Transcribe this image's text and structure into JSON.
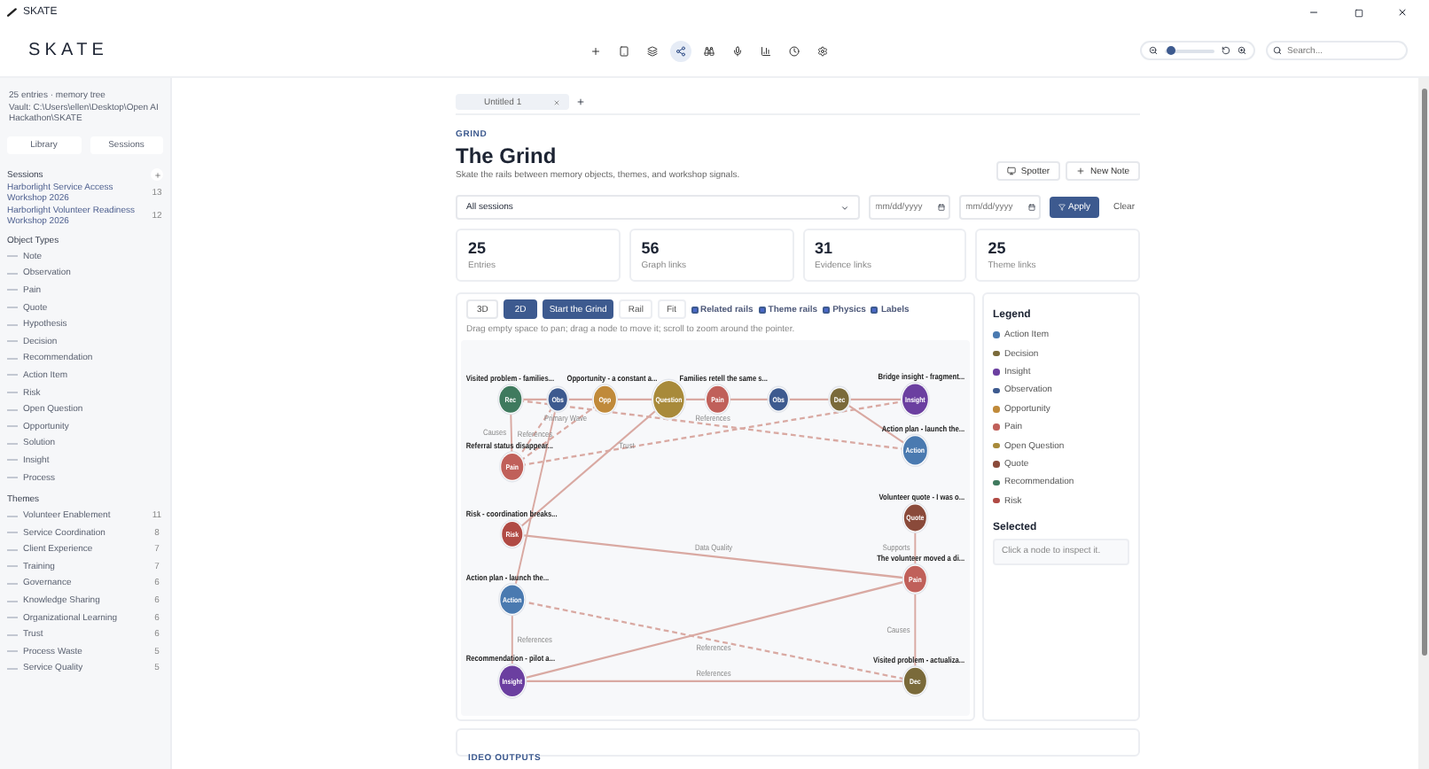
{
  "window": {
    "title": "SKATE"
  },
  "app_bar": {
    "logo": "SKATE",
    "tools": [
      {
        "kind": "add",
        "selected": false
      },
      {
        "kind": "tablet",
        "selected": false
      },
      {
        "kind": "layers",
        "selected": false
      },
      {
        "kind": "graph",
        "selected": true
      },
      {
        "kind": "binoculars",
        "selected": false
      },
      {
        "kind": "mic",
        "selected": false
      },
      {
        "kind": "chart",
        "selected": false
      },
      {
        "kind": "clock",
        "selected": false
      },
      {
        "kind": "settings",
        "selected": false
      }
    ],
    "zoom": {
      "level": 0.12
    },
    "search": {
      "placeholder": "Search..."
    }
  },
  "sidebar": {
    "info": [
      "25 entries · memory tree",
      "Vault: C:\\Users\\ellen\\Desktop\\Open AI Hackathon\\SKATE"
    ],
    "buttons": [
      "Library",
      "Sessions"
    ],
    "sessions_heading": "Sessions",
    "sessions": [
      {
        "label": "Harborlight Service Access Workshop 2026",
        "count": "13"
      },
      {
        "label": "Harborlight Volunteer Readiness Workshop 2026",
        "count": "12"
      }
    ],
    "object_types_heading": "Object Types",
    "object_types": [
      "Note",
      "Observation",
      "Pain",
      "Quote",
      "Hypothesis",
      "Decision",
      "Recommendation",
      "Action Item",
      "Risk",
      "Open Question",
      "Opportunity",
      "Solution",
      "Insight",
      "Process"
    ],
    "themes_heading": "Themes",
    "themes": [
      {
        "label": "Volunteer Enablement",
        "count": "11"
      },
      {
        "label": "Service Coordination",
        "count": "8"
      },
      {
        "label": "Client Experience",
        "count": "7"
      },
      {
        "label": "Training",
        "count": "7"
      },
      {
        "label": "Governance",
        "count": "6"
      },
      {
        "label": "Knowledge Sharing",
        "count": "6"
      },
      {
        "label": "Organizational Learning",
        "count": "6"
      },
      {
        "label": "Trust",
        "count": "6"
      },
      {
        "label": "Process Waste",
        "count": "5"
      },
      {
        "label": "Service Quality",
        "count": "5"
      }
    ]
  },
  "tabs": [
    {
      "label": "Untitled 1",
      "selected": true
    }
  ],
  "header": {
    "eyebrow": "GRIND",
    "title": "The Grind",
    "subtitle": "Skate the rails between memory objects, themes, and workshop signals.",
    "actions": [
      {
        "kind": "spotter",
        "label": "Spotter"
      },
      {
        "kind": "add",
        "label": "New Note"
      }
    ]
  },
  "filters": {
    "session": "All sessions",
    "date_from": {
      "placeholder": "mm/dd/yyyy"
    },
    "date_to": {
      "placeholder": "mm/dd/yyyy"
    },
    "apply": "Apply",
    "clear": "Clear"
  },
  "stats": [
    {
      "value": "25",
      "label": "Entries"
    },
    {
      "value": "56",
      "label": "Graph links"
    },
    {
      "value": "31",
      "label": "Evidence links"
    },
    {
      "value": "25",
      "label": "Theme links"
    }
  ],
  "graph": {
    "view_modes": [
      {
        "label": "3D",
        "selected": false
      },
      {
        "label": "2D",
        "selected": true
      }
    ],
    "start": "Start the Grind",
    "rail": "Rail",
    "fit": "Fit",
    "toggles": [
      {
        "label": "Related rails",
        "checked": true
      },
      {
        "label": "Theme rails",
        "checked": true
      },
      {
        "label": "Physics",
        "checked": true
      },
      {
        "label": "Labels",
        "checked": true
      }
    ],
    "hint": "Drag empty space to pan; drag a node to move it; scroll to zoom around the pointer.",
    "nodes": [
      {
        "label": "Visited problem - families...",
        "badge": "Rec",
        "color": "#3f7a5e"
      },
      {
        "badge": "Obs",
        "color": "#3d5a8f"
      },
      {
        "label": "Opportunity - a constant a...",
        "badge": "Opp",
        "color": "#c08a3a"
      },
      {
        "badge": "Question",
        "color": "#a88a3a"
      },
      {
        "label": "Families retell the same s...",
        "badge": "Pain",
        "color": "#c0605a"
      },
      {
        "badge": "Obs",
        "color": "#3d5a8f"
      },
      {
        "badge": "Dec",
        "color": "#7a6a3a"
      },
      {
        "label": "Bridge insight - fragment...",
        "badge": "Insight",
        "color": "#6b3fa0"
      },
      {
        "label": "Action plan - launch the...",
        "badge": "Action",
        "color": "#4a7ab0"
      },
      {
        "label": "Referral status disappear...",
        "badge": "Pain",
        "color": "#c0605a"
      },
      {
        "label": "Risk - coordination breaks...",
        "badge": "Risk",
        "color": "#b04a44"
      },
      {
        "label": "Action plan - launch the...",
        "badge": "Action",
        "color": "#4a7ab0"
      },
      {
        "label": "Recommendation - pilot a...",
        "badge": "Insight",
        "color": "#6b3fa0"
      },
      {
        "label": "Volunteer quote - I was o...",
        "badge": "Quote",
        "color": "#8a4a3a"
      },
      {
        "label": "The volunteer moved a di...",
        "badge": "Pain",
        "color": "#c0605a"
      },
      {
        "label": "Visited problem - actualiza...",
        "badge": "Dec",
        "color": "#7a6a3a"
      }
    ],
    "edges": [
      {
        "label": "Causes"
      },
      {
        "dashed": true,
        "label": "References"
      },
      {
        "dashed": true,
        "label": "Primary Wave"
      },
      {
        "dashed": true,
        "label": "References"
      },
      {
        "dashed": true
      },
      {
        "label": "Trust"
      },
      {
        "label": "Data Quality"
      },
      {
        "dashed": true,
        "label": "References"
      },
      {
        "label": "References"
      },
      {
        "label": "References"
      },
      {
        "label": "Supports"
      },
      {
        "label": "Causes"
      }
    ]
  },
  "legend": {
    "heading": "Legend",
    "items": [
      {
        "label": "Action Item",
        "color": "#4a7ab0"
      },
      {
        "label": "Decision",
        "color": "#7a6a3a"
      },
      {
        "label": "Insight",
        "color": "#6b3fa0"
      },
      {
        "label": "Observation",
        "color": "#3d5a8f"
      },
      {
        "label": "Opportunity",
        "color": "#c08a3a"
      },
      {
        "label": "Pain",
        "color": "#c0605a"
      },
      {
        "label": "Open Question",
        "color": "#a88a3a"
      },
      {
        "label": "Quote",
        "color": "#8a4a3a"
      },
      {
        "label": "Recommendation",
        "color": "#3f7a5e"
      },
      {
        "label": "Risk",
        "color": "#b04a44"
      }
    ],
    "selected_heading": "Selected",
    "selected_placeholder": "Click a node to inspect it."
  },
  "next_section": {
    "title": "IDEO OUTPUTS"
  }
}
